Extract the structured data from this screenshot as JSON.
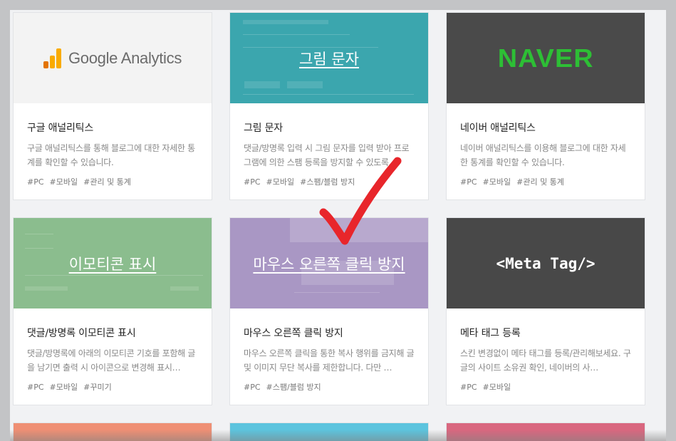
{
  "cards": [
    {
      "title": "구글 애널리틱스",
      "desc": "구글 애널리틱스를 통해 블로그에 대한 자세한 통계를 확인할 수 있습니다.",
      "tags": [
        "#PC",
        "#모바일",
        "#관리 및 통계"
      ],
      "logo_text": "Google Analytics",
      "thumb_color": "#f3f3f3"
    },
    {
      "title": "그림 문자",
      "desc": "댓글/방명록 입력 시 그림 문자를 입력 받아 프로그램에 의한 스팸 등록을 방지할 수 있도록…",
      "tags": [
        "#PC",
        "#모바일",
        "#스팸/블럼 방지"
      ],
      "caption": "그림 문자",
      "thumb_color": "#3ba6ae"
    },
    {
      "title": "네이버 애널리틱스",
      "desc": "네이버 애널리틱스를 이용해 블로그에 대한 자세한 통계를 확인할 수 있습니다.",
      "tags": [
        "#PC",
        "#모바일",
        "#관리 및 통계"
      ],
      "logo_text": "NAVER",
      "thumb_color": "#4a4a4a"
    },
    {
      "title": "댓글/방명록 이모티콘 표시",
      "desc": "댓글/방명록에 아래의 이모티콘 기호를 포함해 글을 남기면 출력 시 아이콘으로 변경해 표시…",
      "tags": [
        "#PC",
        "#모바일",
        "#꾸미기"
      ],
      "caption": "이모티콘 표시",
      "thumb_color": "#8bbd8e"
    },
    {
      "title": "마우스 오른쪽 클릭 방지",
      "desc": "마우스 오른쪽 클릭을 통한 복사 행위를 금지해 글 및 이미지 무단 복사를 제한합니다. 다만 …",
      "tags": [
        "#PC",
        "#스팸/블럼 방지"
      ],
      "caption": "마우스 오른쪽 클릭 방지",
      "thumb_color": "#a997c4"
    },
    {
      "title": "메타 태그 등록",
      "desc": "스킨 변경없이 메타 태그를 등록/관리해보세요. 구글의 사이트 소유권 확인, 네이버의 사…",
      "tags": [
        "#PC",
        "#모바일"
      ],
      "caption": "<Meta Tag/>",
      "thumb_color": "#484848"
    }
  ],
  "partial_row_colors": [
    "#ef8f74",
    "#5cc4de",
    "#d9677f"
  ],
  "colors": {
    "ga_orange": "#f9ab00",
    "ga_dark_orange": "#e37400",
    "checkmark": "#e8262b"
  }
}
